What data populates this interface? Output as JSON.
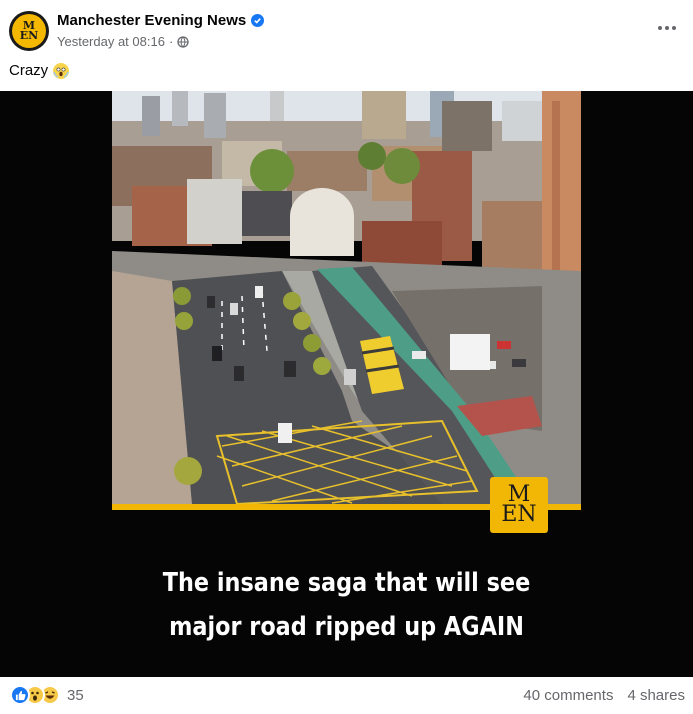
{
  "post": {
    "page_name": "Manchester Evening News",
    "avatar_text": "MEN",
    "timestamp": "Yesterday at 08:16",
    "separator": "·",
    "caption": "Crazy"
  },
  "media": {
    "logo_text_top": "M",
    "logo_text_bottom": "EN",
    "headline_line1": "The insane saga that will see",
    "headline_line2": "major road ripped up AGAIN"
  },
  "footer": {
    "reaction_count": "35",
    "comments": "40 comments",
    "shares": "4 shares"
  },
  "colors": {
    "brand_yellow": "#f2b705",
    "facebook_blue": "#1877f2"
  }
}
